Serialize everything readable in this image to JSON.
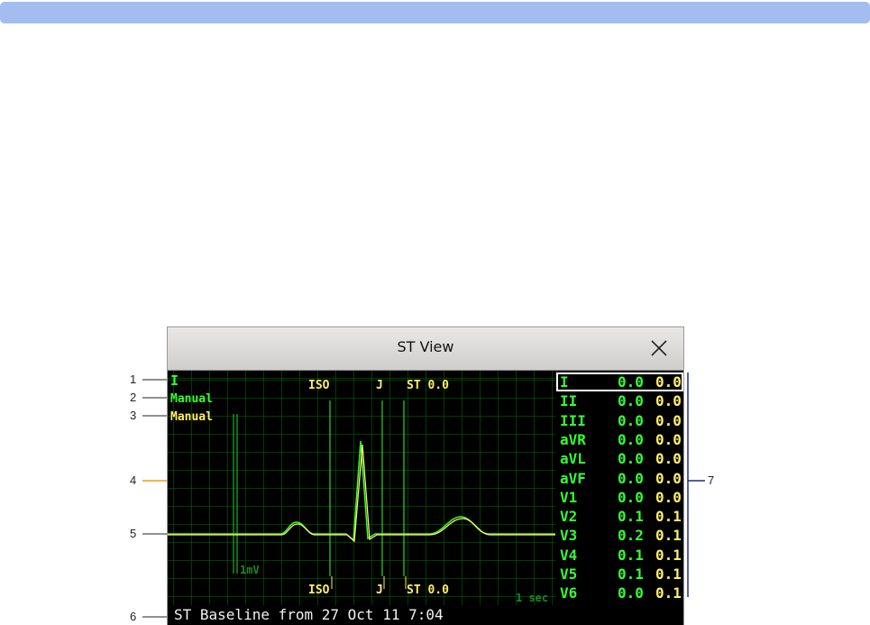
{
  "window": {
    "title": "ST View",
    "close_icon": "close-icon"
  },
  "callouts": [
    "1",
    "2",
    "3",
    "4",
    "5",
    "6",
    "7"
  ],
  "wave": {
    "lead": "I",
    "label_green": "Manual",
    "label_yellow": "Manual",
    "markers": {
      "iso": "ISO",
      "j": "J",
      "st_top": "ST 0.0",
      "st_bottom": "ST 0.0"
    },
    "calibration": "1mV",
    "time_scale": "1 sec"
  },
  "status": "ST Baseline from 27 Oct 11 7:04",
  "st_table": {
    "rows": [
      {
        "lead": "I",
        "current": "0.0",
        "baseline": "0.0",
        "selected": true
      },
      {
        "lead": "II",
        "current": "0.0",
        "baseline": "0.0"
      },
      {
        "lead": "III",
        "current": "0.0",
        "baseline": "0.0"
      },
      {
        "lead": "aVR",
        "current": "0.0",
        "baseline": "0.0"
      },
      {
        "lead": "aVL",
        "current": "0.0",
        "baseline": "0.0"
      },
      {
        "lead": "aVF",
        "current": "0.0",
        "baseline": "0.0"
      },
      {
        "lead": "V1",
        "current": "0.0",
        "baseline": "0.0"
      },
      {
        "lead": "V2",
        "current": "0.1",
        "baseline": "0.1"
      },
      {
        "lead": "V3",
        "current": "0.2",
        "baseline": "0.1"
      },
      {
        "lead": "V4",
        "current": "0.1",
        "baseline": "0.1"
      },
      {
        "lead": "V5",
        "current": "0.1",
        "baseline": "0.1"
      },
      {
        "lead": "V6",
        "current": "0.0",
        "baseline": "0.1"
      }
    ]
  },
  "colors": {
    "top_bar": "#a3bdf0",
    "wave_green": "#33ff33",
    "wave_yellow": "#ffee66",
    "grid": "#006e00",
    "callout_orange": "#f39c12",
    "callout_navy": "#1f2a8c"
  }
}
